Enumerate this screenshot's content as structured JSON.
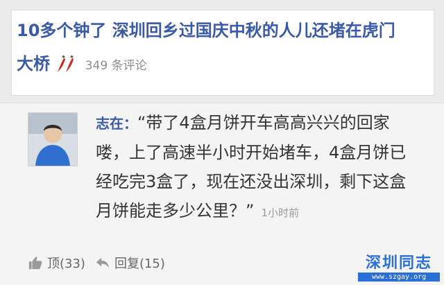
{
  "article": {
    "headline": "10多个钟了 深圳回乡过国庆中秋的人儿还堵在虎门大桥",
    "comment_count": "349 条评论"
  },
  "comment": {
    "author": "志在：",
    "text": "“带了4盒月饼开车高高兴兴的回家喽，上了高速半小时开始堵车，4盒月饼已经吃完3盒了，现在还没出深圳，剩下这盒月饼能走多少公里？”",
    "time": "1小时前",
    "like_label": "顶(33)",
    "reply_label": "回复(15)"
  },
  "watermark": {
    "title": "深圳同志",
    "url": "www.szgay.org"
  },
  "colors": {
    "headline": "#3a5aa8",
    "chili": "#c8281e",
    "watermark": "#2a6fd6"
  }
}
